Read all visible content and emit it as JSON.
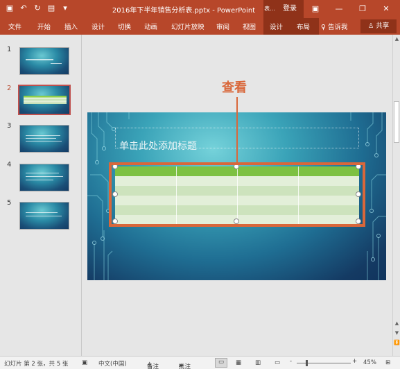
{
  "titlebar": {
    "title": "2016年下半年销售分析表.pptx - PowerPoint",
    "context_label": "表...",
    "login": "登录",
    "minimize": "—",
    "restore": "❐",
    "close": "✕"
  },
  "ribbon": {
    "tabs": [
      "文件",
      "开始",
      "插入",
      "设计",
      "切换",
      "动画",
      "幻灯片放映",
      "审阅",
      "视图"
    ],
    "context_tabs": [
      "设计",
      "布局"
    ],
    "tell_me": "告诉我",
    "share": "共享"
  },
  "thumbnails": [
    {
      "num": "1"
    },
    {
      "num": "2",
      "active": true
    },
    {
      "num": "3"
    },
    {
      "num": "4"
    },
    {
      "num": "5"
    }
  ],
  "slide": {
    "title_placeholder": "单击此处添加标题",
    "callout": "查看"
  },
  "status": {
    "slide_info": "幻灯片 第 2 张，共 5 张",
    "language": "中文(中国)",
    "notes": "备注",
    "comments": "批注",
    "zoom_minus": "-",
    "zoom_plus": "+",
    "zoom": "45%"
  },
  "colors": {
    "accent": "#b7472a",
    "callout": "#d9673a",
    "table_header": "#7dc142"
  }
}
